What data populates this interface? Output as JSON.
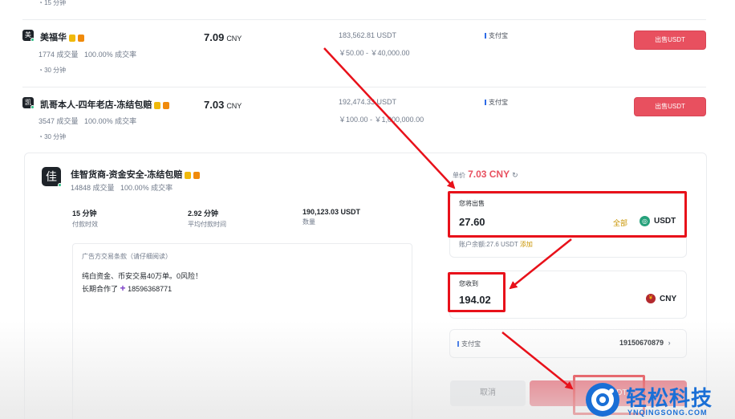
{
  "top_partial": {
    "time": "15 分钟"
  },
  "listings": [
    {
      "avatar": "美",
      "seller": "美福华",
      "orders": "1774 成交量",
      "completion": "100.00% 成交率",
      "time": "30 分钟",
      "price": "7.09",
      "currency": "CNY",
      "available": "183,562.81 USDT",
      "limit": "￥50.00 - ￥40,000.00",
      "payment": "支付宝",
      "action": "出售USDT"
    },
    {
      "avatar": "凯",
      "seller": "凯哥本人-四年老店-冻结包赔",
      "orders": "3547 成交量",
      "completion": "100.00% 成交率",
      "time": "30 分钟",
      "price": "7.03",
      "currency": "CNY",
      "available": "192,474.33 USDT",
      "limit": "￥100.00 - ￥1,000,000.00",
      "payment": "支付宝",
      "action": "出售USDT"
    }
  ],
  "expanded": {
    "avatar": "佳",
    "seller": "佳智货商-资金安全-冻结包赔",
    "orders": "14848 成交量",
    "completion": "100.00% 成交率",
    "stats": [
      {
        "value": "15 分钟",
        "label": "付款时效"
      },
      {
        "value": "2.92 分钟",
        "label": "平均付款时间"
      },
      {
        "value": "190,123.03 USDT",
        "label": "数量"
      }
    ],
    "terms_title": "广告方交易条款（请仔细阅读）",
    "terms_line1": "纯白资金、币安交易40万单。0风险！",
    "terms_line2_prefix": "长期合作了",
    "terms_phone": "18596368771"
  },
  "order_form": {
    "price_label": "单价",
    "price_value": "7.03 CNY",
    "sell_label": "您将出售",
    "sell_amount": "27.60",
    "all_label": "全部",
    "sell_currency": "USDT",
    "balance_text": "账户余额:27.6 USDT",
    "add_label": "添加",
    "receive_label": "您收到",
    "receive_amount": "194.02",
    "receive_currency": "CNY",
    "payment_method": "支付宝",
    "payment_account": "19150670879",
    "cancel_label": "取消",
    "confirm_label": "出售USDT"
  },
  "watermark": {
    "brand": "轻松科技",
    "domain": "YNQINGSONG.COM"
  },
  "colors": {
    "sell_red": "#e8505f",
    "annotation_red": "#e8111a",
    "accent_gold": "#c99400",
    "watermark_blue": "#1a6fd6"
  }
}
